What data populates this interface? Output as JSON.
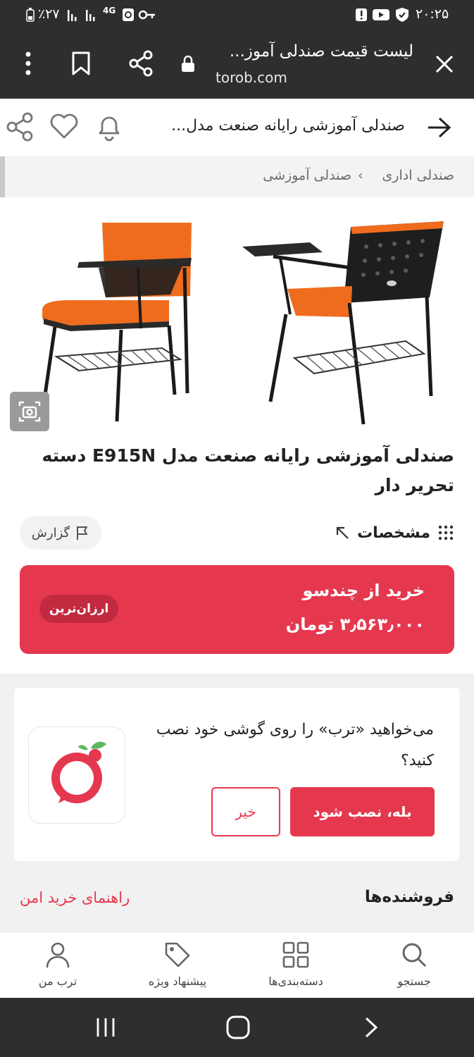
{
  "status_bar": {
    "battery": "٪۲۷",
    "network": "4G",
    "time": "۲۰:۲۵"
  },
  "browser": {
    "title": "لیست قیمت صندلی آموز...",
    "url": "torob.com"
  },
  "header": {
    "title": "صندلی آموزشی رایانه صنعت مدل..."
  },
  "breadcrumb": {
    "items": [
      "صندلی اداری",
      "صندلی آموزشی"
    ],
    "separator": "›"
  },
  "product": {
    "title": "صندلی آموزشی رایانه صنعت مدل E915N دسته تحریر دار",
    "specs_label": "مشخصات",
    "report_label": "گزارش"
  },
  "buy_card": {
    "shop": "خرید از چندسو",
    "price": "۳٫۵۶۳٫۰۰۰ تومان",
    "badge": "ارزان‌ترین"
  },
  "install_prompt": {
    "text": "می‌خواهید «ترب» را روی گوشی خود نصب کنید؟",
    "yes_label": "بله، نصب شود",
    "no_label": "خیر"
  },
  "sellers": {
    "title": "فروشنده‌ها",
    "safe_guide": "راهنمای خرید امن"
  },
  "bottom_nav": {
    "search": "جستجو",
    "categories": "دسته‌بندی‌ها",
    "offers": "پیشنهاد ویژه",
    "profile": "ترب من"
  },
  "colors": {
    "brand_red": "#e5384f",
    "dark_bar": "#2e2e2e",
    "chair_orange": "#ef6c1e"
  }
}
